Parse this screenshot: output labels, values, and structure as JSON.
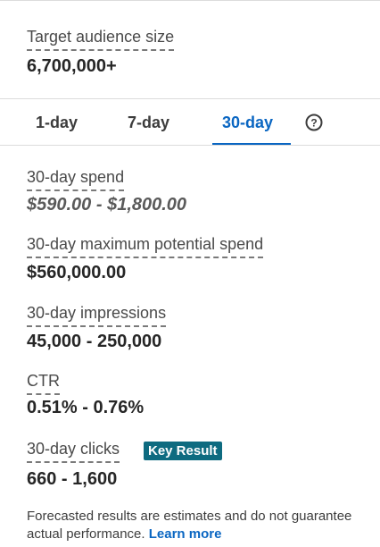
{
  "audience": {
    "label": "Target audience size",
    "value": "6,700,000+"
  },
  "tabs": [
    {
      "label": "1-day",
      "active": false
    },
    {
      "label": "7-day",
      "active": false
    },
    {
      "label": "30-day",
      "active": true
    }
  ],
  "help_icon": "question-circle-icon",
  "metrics": {
    "spend": {
      "label": "30-day spend",
      "value": "$590.00 - $1,800.00"
    },
    "max_spend": {
      "label": "30-day maximum potential spend",
      "value": "$560,000.00"
    },
    "impressions": {
      "label": "30-day impressions",
      "value": "45,000 - 250,000"
    },
    "ctr": {
      "label": "CTR",
      "value": "0.51% - 0.76%"
    },
    "clicks": {
      "label": "30-day clicks",
      "value": "660 - 1,600",
      "badge": "Key Result"
    }
  },
  "footer": {
    "text": "Forecasted results are estimates and do not guarantee actual performance.",
    "link": "Learn more"
  },
  "colors": {
    "accent": "#0a66c2",
    "badge": "#0e6b80"
  }
}
